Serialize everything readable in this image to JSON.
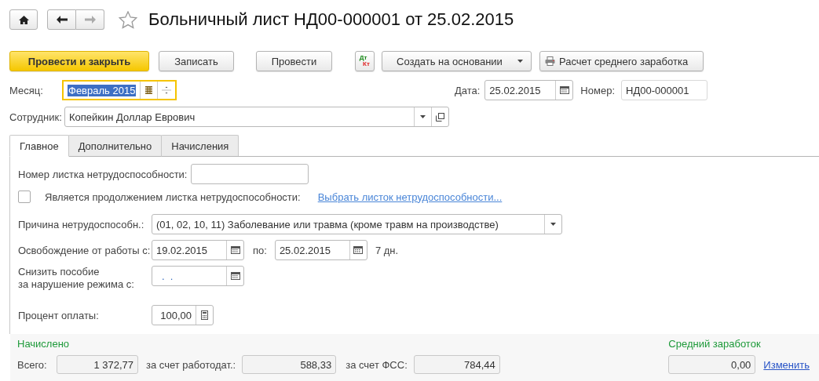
{
  "window": {
    "title": "Больничный лист НД00-000001 от 25.02.2015"
  },
  "toolbar": [
    {
      "kind": "primary",
      "label": "Провести и закрыть"
    },
    {
      "kind": "plain",
      "label": "Записать"
    },
    {
      "kind": "plain",
      "label": "Провести"
    },
    {
      "kind": "dtkt",
      "top": "Дт",
      "bottom": "Кт"
    },
    {
      "kind": "menu",
      "label": "Создать на основании"
    },
    {
      "kind": "print",
      "label": "Расчет среднего заработка"
    }
  ],
  "month": {
    "label": "Месяц:",
    "value": "Февраль 2015",
    "focused": true
  },
  "date": {
    "label": "Дата:",
    "value": "25.02.2015"
  },
  "number": {
    "label": "Номер:",
    "value": "НД00-000001"
  },
  "employee": {
    "label": "Сотрудник:",
    "value": "Копейкин Доллар Еврович"
  },
  "tabs": [
    {
      "label": "Главное",
      "selected": true
    },
    {
      "label": "Дополнительно",
      "selected": false
    },
    {
      "label": "Начисления",
      "selected": false
    }
  ],
  "main": {
    "sick_note_number": {
      "label": "Номер листка нетрудоспособности:"
    },
    "continuation": {
      "label": "Является продолжением листка нетрудоспособности:",
      "checked": false,
      "link": "Выбрать листок нетрудоспособности..."
    },
    "reason": {
      "label": "Причина нетрудоспособн.:",
      "value": "(01, 02, 10, 11) Заболевание или травма (кроме травм на производстве)"
    },
    "release": {
      "label": "Освобождение от работы с:",
      "from": "19.02.2015",
      "to_label": "по:",
      "to": "25.02.2015",
      "days": "7 дн."
    },
    "reduce": {
      "label": "Снизить пособие\nза нарушение режима с:",
      "value": ".  ."
    },
    "percent": {
      "label": "Процент оплаты:",
      "value": "100,00"
    }
  },
  "accrued": {
    "title": "Начислено",
    "fields": [
      {
        "label": "Всего:",
        "value": "1 372,77"
      },
      {
        "label": "за счет работодат.:",
        "value": "588,33"
      },
      {
        "label": "за счет ФСС:",
        "value": "784,44"
      }
    ]
  },
  "average": {
    "title": "Средний заработок",
    "value": "0,00",
    "link": "Изменить"
  }
}
